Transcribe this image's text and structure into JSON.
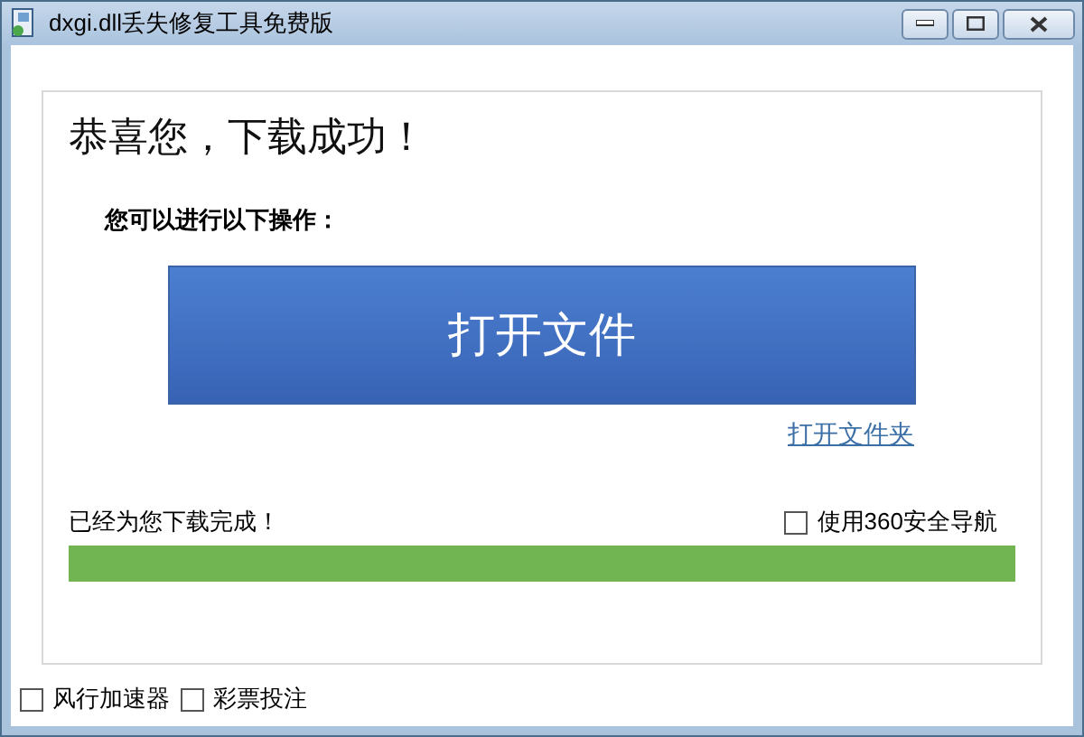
{
  "window": {
    "title": "dxgi.dll丢失修复工具免费版"
  },
  "heading": "恭喜您，下载成功！",
  "subheading": "您可以进行以下操作：",
  "open_file_button": "打开文件",
  "open_folder_link": "打开文件夹",
  "download_status": "已经为您下载完成！",
  "nav_option": {
    "label": "使用360安全导航",
    "checked": false
  },
  "progress": {
    "level": 1
  },
  "bottom_options": [
    {
      "label": "风行加速器",
      "checked": false
    },
    {
      "label": "彩票投注",
      "checked": false
    }
  ]
}
